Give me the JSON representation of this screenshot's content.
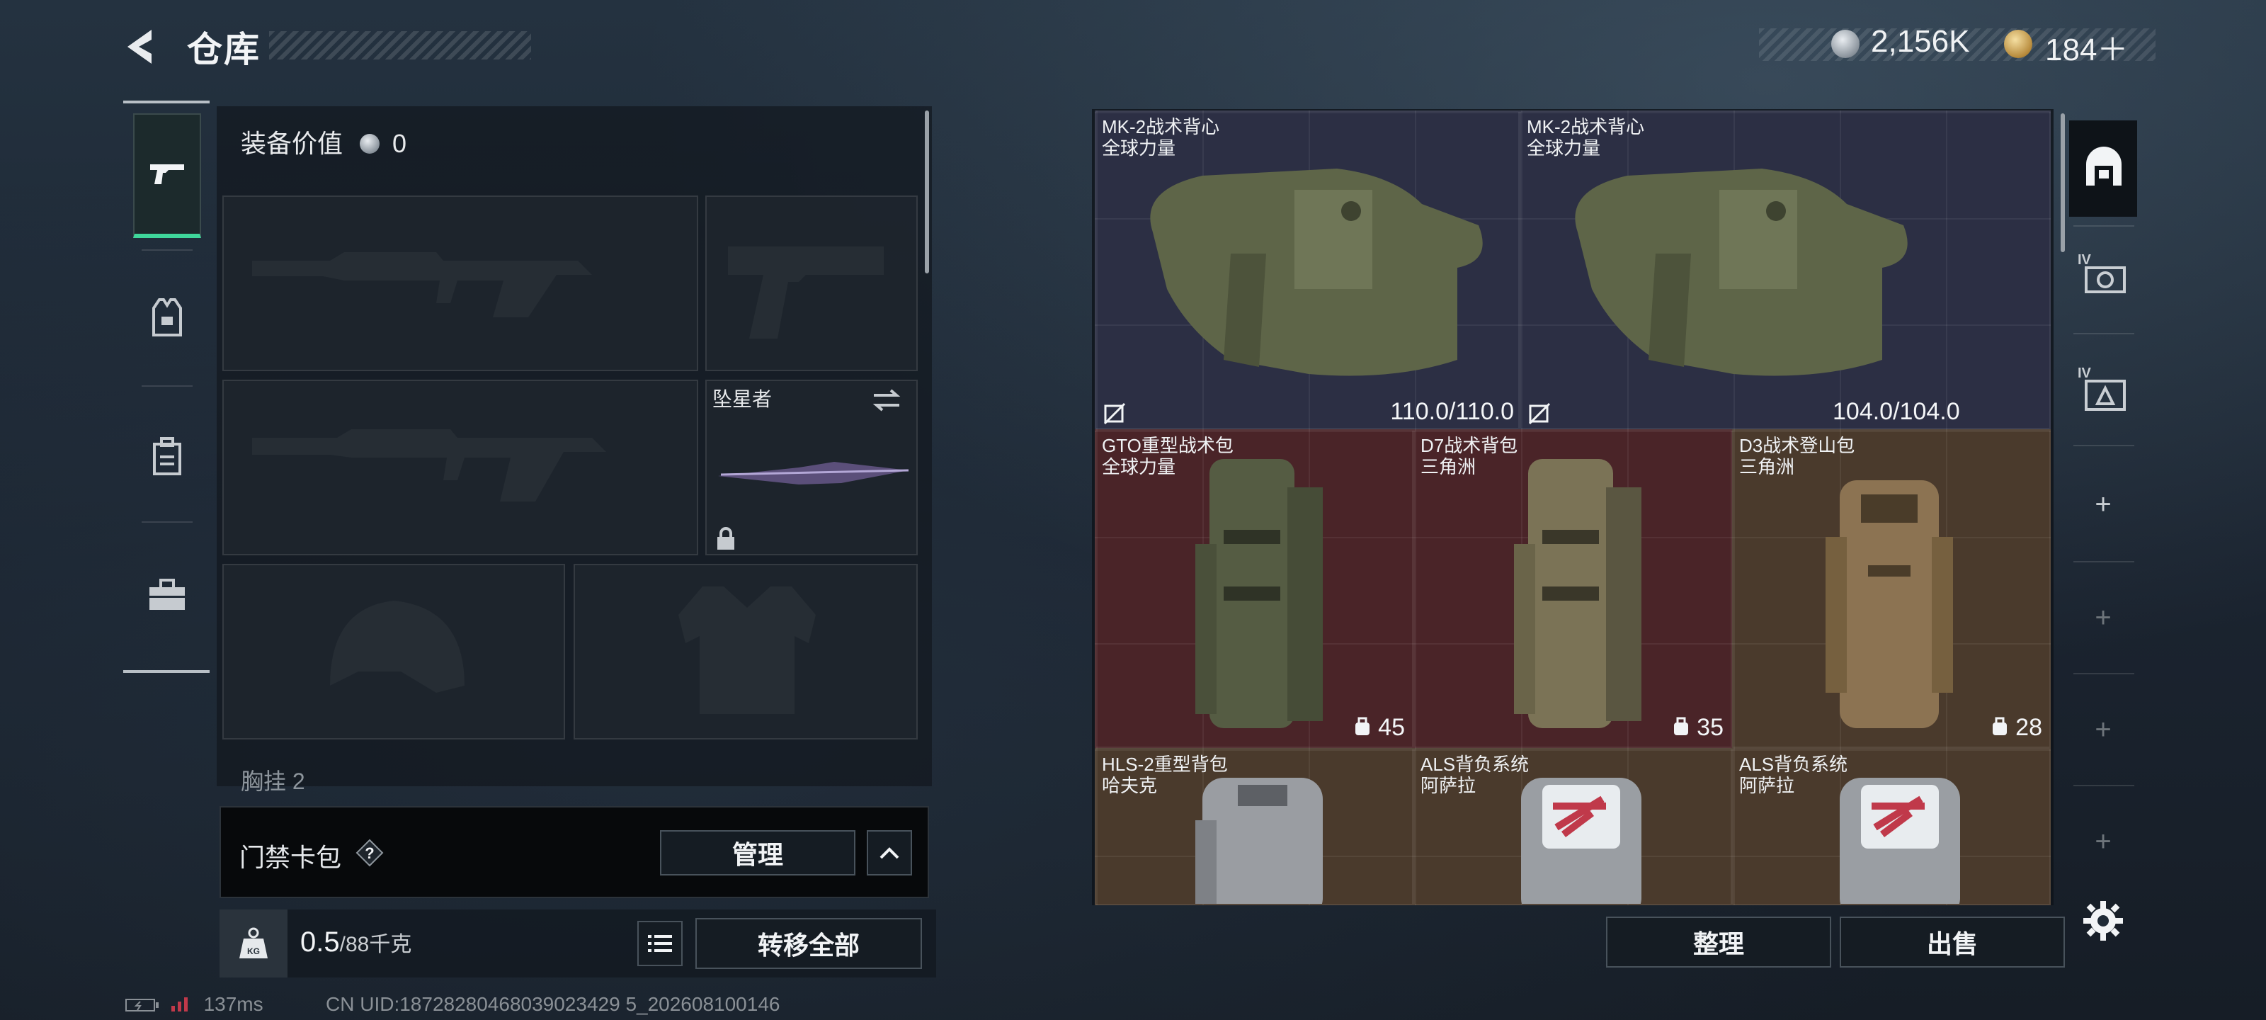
{
  "header": {
    "title": "仓库",
    "currency": {
      "money": "2,156K",
      "tickets": "184＋"
    }
  },
  "left_tabs": [
    "weapon-tab",
    "vest-tab",
    "backpack-tab",
    "case-tab"
  ],
  "equipment": {
    "value_label": "装备价值",
    "value": "0",
    "melee_name": "坠星者",
    "chest_label": "胸挂 2"
  },
  "card_bag": {
    "title": "门禁卡包",
    "help": "?",
    "manage_label": "管理"
  },
  "weight": {
    "current": "0.5",
    "max": "/88千克"
  },
  "transfer_all_label": "转移全部",
  "inventory": {
    "vests": [
      {
        "name": "MK-2战术背心",
        "brand": "全球力量",
        "durability": "110.0/110.0"
      },
      {
        "name": "MK-2战术背心",
        "brand": "全球力量",
        "durability": "104.0/104.0"
      }
    ],
    "packs_row1": [
      {
        "name": "GTO重型战术包",
        "brand": "全球力量",
        "capacity": "45"
      },
      {
        "name": "D7战术背包",
        "brand": "三角洲",
        "capacity": "35"
      },
      {
        "name": "D3战术登山包",
        "brand": "三角洲",
        "capacity": "28"
      }
    ],
    "packs_row2": [
      {
        "name": "HLS-2重型背包",
        "brand": "哈夫克"
      },
      {
        "name": "ALS背负系统",
        "brand": "阿萨拉"
      },
      {
        "name": "ALS背负系统",
        "brand": "阿萨拉"
      }
    ]
  },
  "buttons": {
    "sort": "整理",
    "sell": "出售"
  },
  "right_rail": {
    "labels": [
      "IV",
      "IV"
    ]
  },
  "status": {
    "ping": "137ms",
    "uid": "CN UID:18728280468039023429 5_202608100146"
  },
  "colors": {
    "accent": "#3fd79b",
    "cell_blue": "#2c2f44",
    "cell_red": "#4a2428",
    "cell_brown": "#4a3a2c"
  }
}
